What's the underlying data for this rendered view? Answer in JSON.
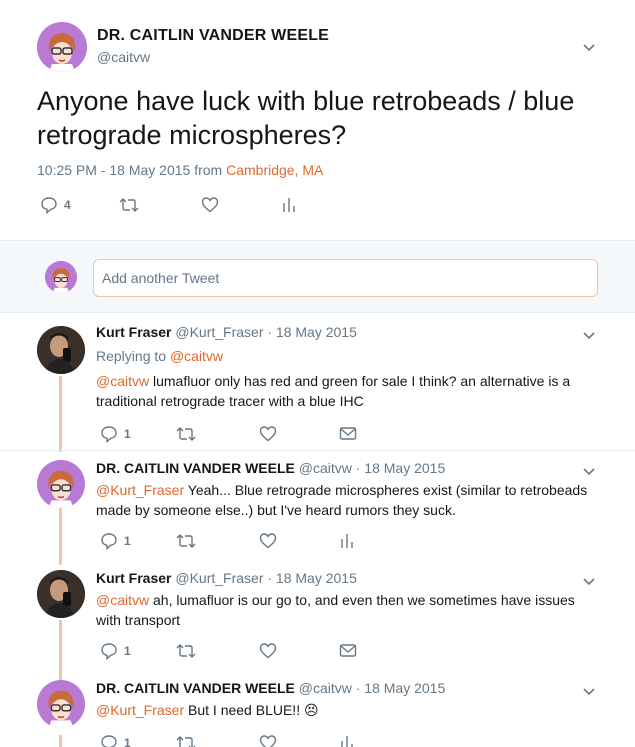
{
  "main_tweet": {
    "name": "DR. CAITLIN VANDER WEELE",
    "handle": "@caitvw",
    "text": "Anyone have luck with blue retrobeads / blue retrograde microspheres?",
    "time": "10:25 PM - 18 May 2015 from ",
    "location": "Cambridge, MA",
    "reply_count": "4"
  },
  "compose": {
    "placeholder": "Add another Tweet"
  },
  "replies": [
    {
      "name": "Kurt Fraser",
      "handle": "@Kurt_Fraser",
      "date": " · 18 May 2015",
      "replying_label": "Replying to ",
      "replying_to": "@caitvw",
      "mention": "@caitvw",
      "text": " lumafluor only has red and green for sale I think? an alternative is a traditional retrograde tracer with a blue IHC",
      "reply_count": "1"
    },
    {
      "name": "DR. CAITLIN VANDER WEELE",
      "handle": "@caitvw",
      "date": " · 18 May 2015",
      "mention": "@Kurt_Fraser",
      "text": " Yeah... Blue retrograde microspheres exist (similar to retrobeads made by someone else..) but I've heard rumors they suck.",
      "reply_count": "1"
    },
    {
      "name": "Kurt Fraser",
      "handle": "@Kurt_Fraser",
      "date": " · 18 May 2015",
      "mention": "@caitvw",
      "text": " ah, lumafluor is our go to, and even then we sometimes have issues with transport",
      "reply_count": "1"
    },
    {
      "name": "DR. CAITLIN VANDER WEELE",
      "handle": "@caitvw",
      "date": " · 18 May 2015",
      "mention": "@Kurt_Fraser",
      "text": " But I need BLUE!! ",
      "emoji": "😣",
      "reply_count": "1"
    }
  ],
  "colors": {
    "accent": "#e0672c",
    "muted": "#657786",
    "thread": "#f6c2a8",
    "avatar_purple": "#b97ad6"
  }
}
